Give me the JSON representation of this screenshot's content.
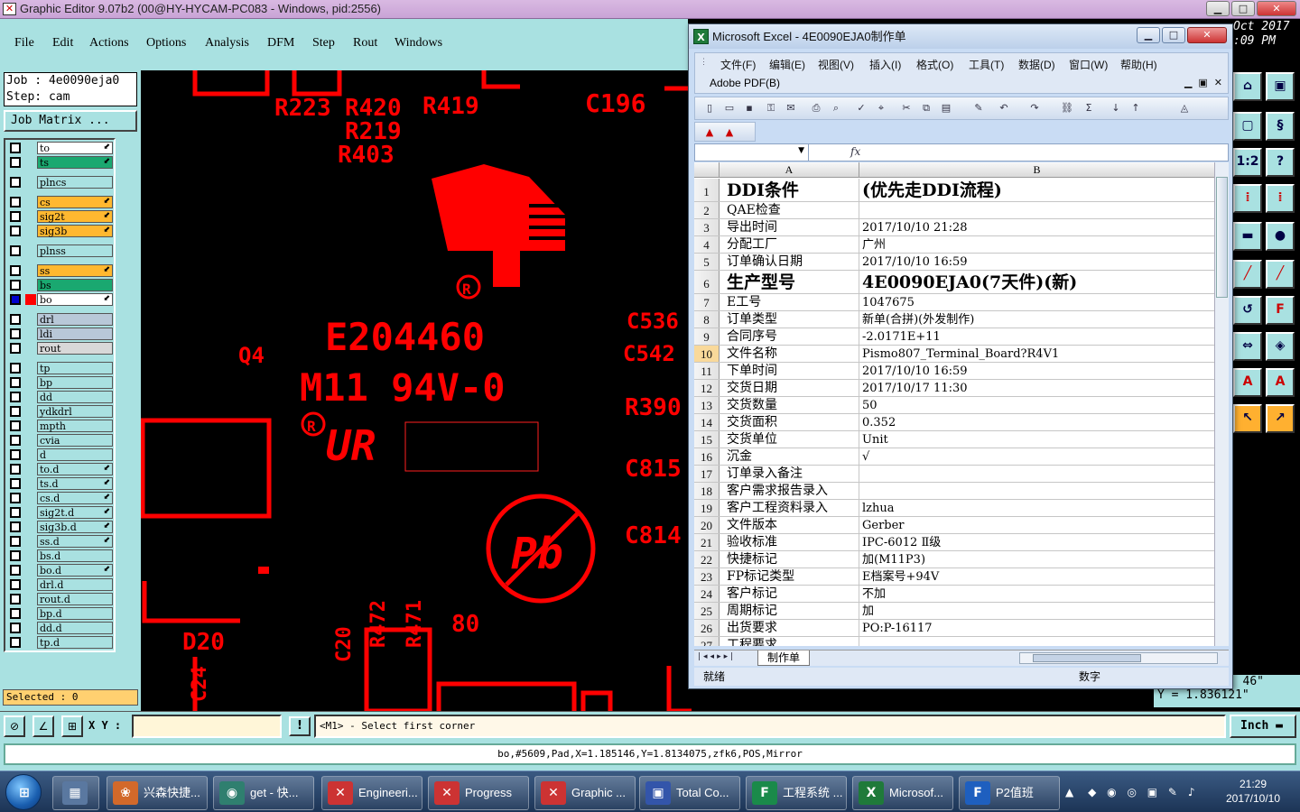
{
  "app": {
    "title": "Graphic Editor 9.07b2 (00@HY-HYCAM-PC083 - Windows, pid:2556)",
    "menu": [
      "File",
      "Edit",
      "Actions",
      "Options",
      "Analysis",
      "DFM",
      "Step",
      "Rout",
      "Windows"
    ],
    "job_line": "Job : 4e0090eja0",
    "step_line": "Step: cam",
    "job_matrix_label": "Job Matrix ...",
    "selected_label": "Selected : 0",
    "date_line1": "Oct 2017",
    "date_line2": ":09 PM",
    "coord_line1": "46\"",
    "coord_line2": "Y = 1.836121\"",
    "xy_label": "X Y :",
    "xy_value": "",
    "prompt": "<M1> - Select first corner",
    "unit": "Inch",
    "status": "bo,#5609,Pad,X=1.185146,Y=1.8134075,zfk6,POS,Mirror"
  },
  "layers": [
    {
      "name": "to",
      "color": "#ffffff",
      "arrow": true
    },
    {
      "name": "ts",
      "color": "#1aa870",
      "arrow": true
    },
    {
      "name": "plncs",
      "color": "#a9e1e1",
      "arrow": false
    },
    {
      "name": "cs",
      "color": "#ffb830",
      "arrow": true
    },
    {
      "name": "sig2t",
      "color": "#ffb830",
      "arrow": true
    },
    {
      "name": "sig3b",
      "color": "#ffb830",
      "arrow": true
    },
    {
      "name": "plnss",
      "color": "#a9e1e1",
      "arrow": false
    },
    {
      "name": "ss",
      "color": "#ffb830",
      "arrow": true
    },
    {
      "name": "bs",
      "color": "#1aa870",
      "arrow": false
    },
    {
      "name": "bo",
      "color": "#ffffff",
      "arrow": true
    },
    {
      "name": "drl",
      "color": "#b8c8d8",
      "arrow": false
    },
    {
      "name": "ldi",
      "color": "#b8c8d8",
      "arrow": false
    },
    {
      "name": "rout",
      "color": "#d8d8d8",
      "arrow": false
    },
    {
      "name": "tp",
      "color": "#a9e1e1",
      "arrow": false
    },
    {
      "name": "bp",
      "color": "#a9e1e1",
      "arrow": false
    },
    {
      "name": "dd",
      "color": "#a9e1e1",
      "arrow": false
    },
    {
      "name": "ydkdrl",
      "color": "#a9e1e1",
      "arrow": false
    },
    {
      "name": "mpth",
      "color": "#a9e1e1",
      "arrow": false
    },
    {
      "name": "cvia",
      "color": "#a9e1e1",
      "arrow": false
    },
    {
      "name": "d",
      "color": "#a9e1e1",
      "arrow": false
    },
    {
      "name": "to.d",
      "color": "#a9e1e1",
      "arrow": true
    },
    {
      "name": "ts.d",
      "color": "#a9e1e1",
      "arrow": true
    },
    {
      "name": "cs.d",
      "color": "#a9e1e1",
      "arrow": true
    },
    {
      "name": "sig2t.d",
      "color": "#a9e1e1",
      "arrow": true
    },
    {
      "name": "sig3b.d",
      "color": "#a9e1e1",
      "arrow": true
    },
    {
      "name": "ss.d",
      "color": "#a9e1e1",
      "arrow": true
    },
    {
      "name": "bs.d",
      "color": "#a9e1e1",
      "arrow": false
    },
    {
      "name": "bo.d",
      "color": "#a9e1e1",
      "arrow": true
    },
    {
      "name": "drl.d",
      "color": "#a9e1e1",
      "arrow": false
    },
    {
      "name": "rout.d",
      "color": "#a9e1e1",
      "arrow": false
    },
    {
      "name": "bp.d",
      "color": "#a9e1e1",
      "arrow": false
    },
    {
      "name": "dd.d",
      "color": "#a9e1e1",
      "arrow": false
    },
    {
      "name": "tp.d",
      "color": "#a9e1e1",
      "arrow": false
    }
  ],
  "canvas_labels": [
    "C196",
    "R419",
    "R420",
    "R223",
    "R219",
    "R403",
    "E204460",
    "M11 94V-0",
    "C536",
    "C542",
    "Q4",
    "R390",
    "C815",
    "C814",
    "D20",
    "C20",
    "R472",
    "R471",
    "80",
    "C24"
  ],
  "excel": {
    "title": "Microsoft Excel - 4E0090EJA0制作单",
    "menu": [
      "文件(F)",
      "编辑(E)",
      "视图(V)",
      "插入(I)",
      "格式(O)",
      "工具(T)",
      "数据(D)",
      "窗口(W)",
      "帮助(H)"
    ],
    "pdf_menu": "Adobe PDF(B)",
    "fx": "fx",
    "col_a": "A",
    "col_b": "B",
    "rows": [
      {
        "n": "1",
        "a": "DDI条件",
        "b": "(优先走DDI流程)",
        "big": true
      },
      {
        "n": "2",
        "a": "QAE检查",
        "b": ""
      },
      {
        "n": "3",
        "a": "导出时间",
        "b": "2017/10/10 21:28"
      },
      {
        "n": "4",
        "a": "分配工厂",
        "b": "广州"
      },
      {
        "n": "5",
        "a": "订单确认日期",
        "b": "2017/10/10 16:59"
      },
      {
        "n": "6",
        "a": "生产型号",
        "b": "4E0090EJA0(7天件)(新)",
        "big": true
      },
      {
        "n": "7",
        "a": "E工号",
        "b": "1047675"
      },
      {
        "n": "8",
        "a": "订单类型",
        "b": "新单(合拼)(外发制作)"
      },
      {
        "n": "9",
        "a": "合同序号",
        "b": "-2.0171E+11"
      },
      {
        "n": "10",
        "a": "文件名称",
        "b": "Pismo807_Terminal_Board?R4V1"
      },
      {
        "n": "11",
        "a": "下单时间",
        "b": "2017/10/10 16:59"
      },
      {
        "n": "12",
        "a": "交货日期",
        "b": "2017/10/17 11:30"
      },
      {
        "n": "13",
        "a": "交货数量",
        "b": "50"
      },
      {
        "n": "14",
        "a": "交货面积",
        "b": "0.352"
      },
      {
        "n": "15",
        "a": "交货单位",
        "b": "Unit"
      },
      {
        "n": "16",
        "a": "沉金",
        "b": "√"
      },
      {
        "n": "17",
        "a": "订单录入备注",
        "b": ""
      },
      {
        "n": "18",
        "a": "客户需求报告录入",
        "b": ""
      },
      {
        "n": "19",
        "a": "客户工程资料录入",
        "b": "lzhua"
      },
      {
        "n": "20",
        "a": "文件版本",
        "b": "Gerber"
      },
      {
        "n": "21",
        "a": "验收标准",
        "b": "IPC-6012 Ⅱ级"
      },
      {
        "n": "22",
        "a": "快捷标记",
        "b": "加(M11P3)"
      },
      {
        "n": "23",
        "a": "FP标记类型",
        "b": "E档案号+94V"
      },
      {
        "n": "24",
        "a": "客户标记",
        "b": "不加"
      },
      {
        "n": "25",
        "a": "周期标记",
        "b": "加"
      },
      {
        "n": "26",
        "a": "出货要求",
        "b": "PO:P-16117"
      },
      {
        "n": "27",
        "a": "工程要求",
        "b": ""
      }
    ],
    "active_row": "10",
    "sheet_tab": "制作单",
    "status_left": "就绪",
    "status_right": "数字"
  },
  "taskbar": {
    "items": [
      {
        "label": "兴森快捷...",
        "icon_color": "#d2692a",
        "icon": "❀"
      },
      {
        "label": "get - 快...",
        "icon_color": "#2f7f6f",
        "icon": "◉"
      },
      {
        "label": "Engineeri...",
        "icon_color": "#c33",
        "icon": "✕"
      },
      {
        "label": "Progress",
        "icon_color": "#c33",
        "icon": "✕"
      },
      {
        "label": "Graphic ...",
        "icon_color": "#c33",
        "icon": "✕"
      },
      {
        "label": "Total Co...",
        "icon_color": "#3355aa",
        "icon": "▣"
      },
      {
        "label": "工程系统 ...",
        "icon_color": "#1a8a4a",
        "icon": "F"
      },
      {
        "label": "Microsof...",
        "icon_color": "#1f7a3a",
        "icon": "X"
      },
      {
        "label": "P2值班",
        "icon_color": "#1e5fbf",
        "icon": "F"
      }
    ],
    "time": "21:29",
    "date": "2017/10/10"
  },
  "colors": {
    "accent_cyan": "#a9e1e1",
    "pcb_red": "#ff0000",
    "excel_green": "#1f7a3a"
  }
}
